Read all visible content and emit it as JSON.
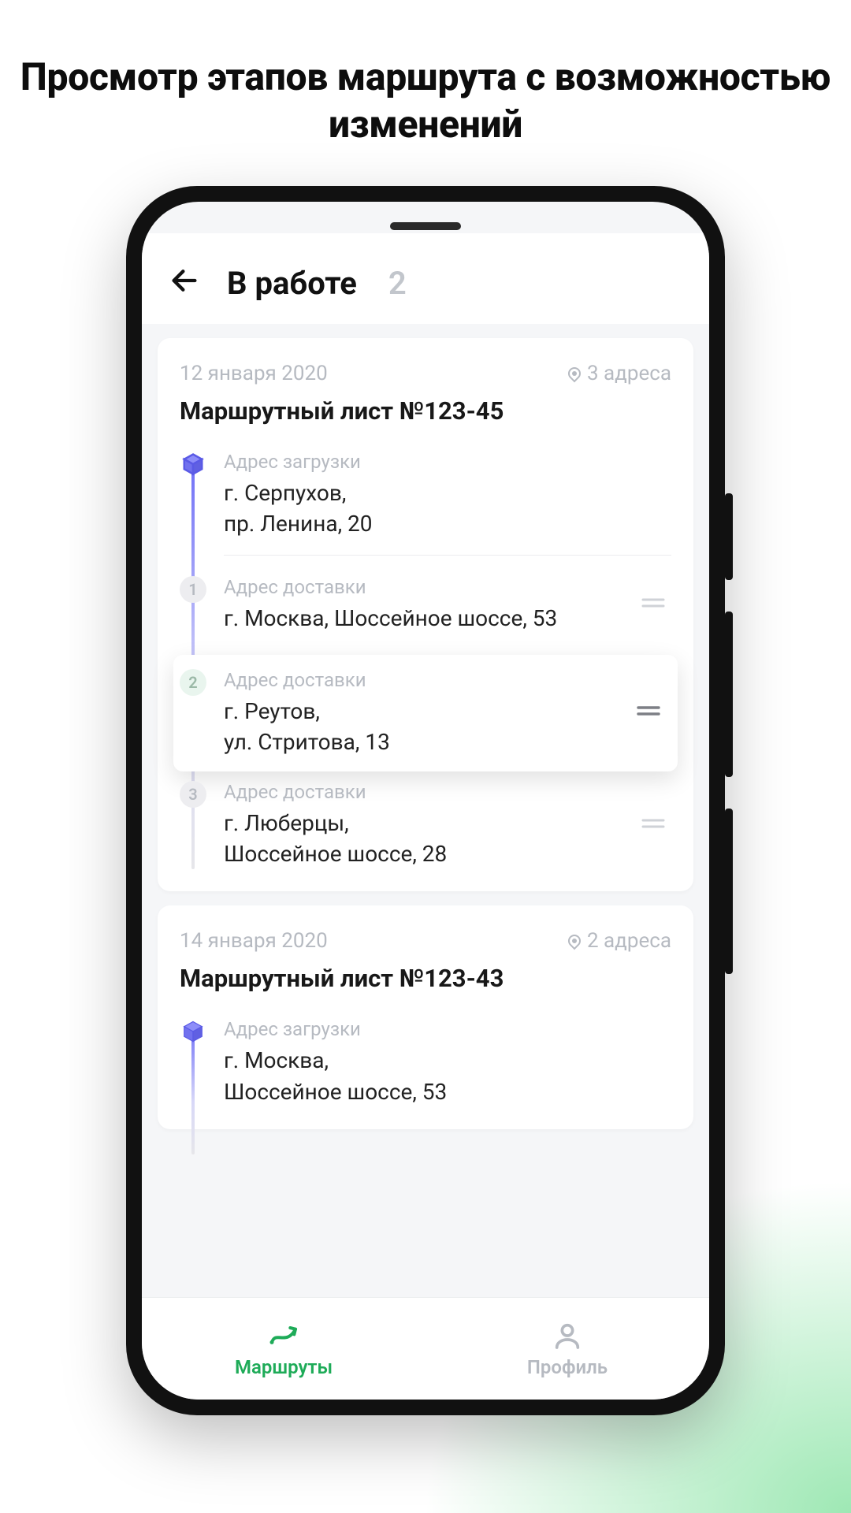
{
  "promo_title": "Просмотр этапов маршрута с возможностью изменений",
  "header": {
    "title": "В работе",
    "count": "2"
  },
  "cards": [
    {
      "date": "12 января 2020",
      "addr_count": "3 адреса",
      "title": "Маршрутный лист №123-45",
      "steps": [
        {
          "kind": "pickup",
          "label": "Адрес загрузки",
          "address": "г. Серпухов,\nпр. Ленина, 20"
        },
        {
          "kind": "deliver",
          "num": "1",
          "label": "Адрес доставки",
          "address": "г. Москва, Шоссейное шоссе, 53"
        },
        {
          "kind": "deliver",
          "num": "2",
          "floating": true,
          "label": "Адрес доставки",
          "address": "г. Реутов,\nул. Стритова, 13"
        },
        {
          "kind": "deliver",
          "num": "3",
          "label": "Адрес доставки",
          "address": "г. Люберцы,\nШоссейное шоссе, 28"
        }
      ]
    },
    {
      "date": "14 января 2020",
      "addr_count": "2 адреса",
      "title": "Маршрутный лист №123-43",
      "steps": [
        {
          "kind": "pickup",
          "label": "Адрес загрузки",
          "address": "г. Москва,\nШоссейное шоссе, 53"
        }
      ]
    }
  ],
  "nav": {
    "routes": "Маршруты",
    "profile": "Профиль"
  }
}
